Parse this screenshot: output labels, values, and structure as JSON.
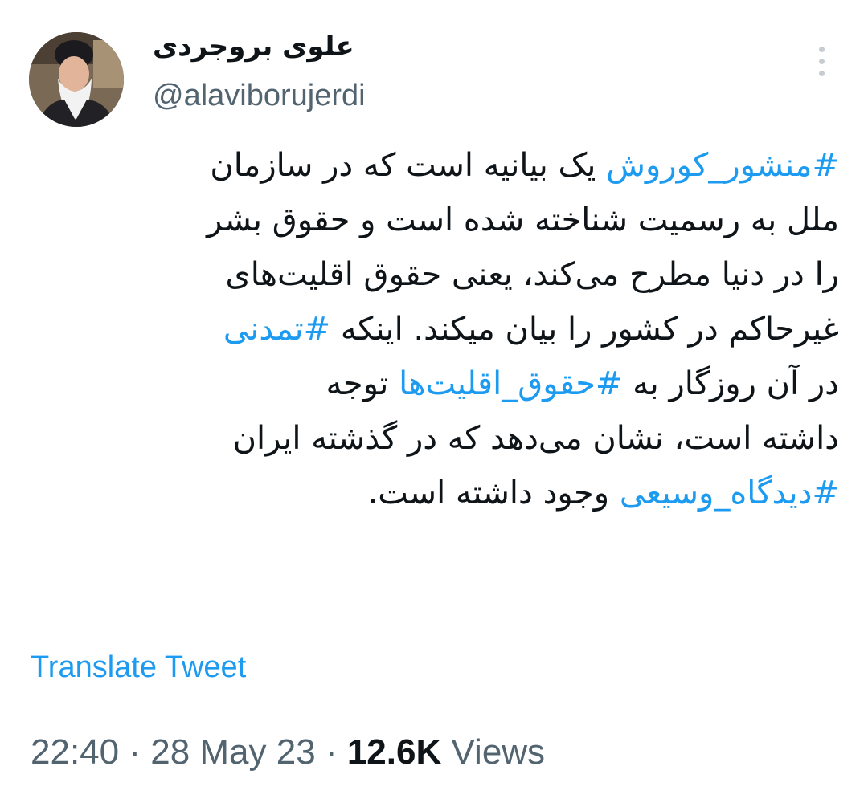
{
  "author": {
    "display_name": "علوی بروجردی",
    "handle": "@alaviborujerdi"
  },
  "tweet": {
    "lines": [
      [
        {
          "text": "#منشور_کوروش",
          "tag": true
        },
        {
          "text": " یک بیانیه است که در سازمان",
          "tag": false
        }
      ],
      [
        {
          "text": "ملل به رسمیت شناخته شده است و حقوق بشر",
          "tag": false
        }
      ],
      [
        {
          "text": "را در دنیا مطرح می‌کند، یعنی حقوق اقلیت‌های",
          "tag": false
        }
      ],
      [
        {
          "text": "غیرحاکم در کشور را بیان میکند. اینکه ",
          "tag": false
        },
        {
          "text": "#تمدنی",
          "tag": true
        }
      ],
      [
        {
          "text": "در آن روزگار به ",
          "tag": false
        },
        {
          "text": "#حقوق_اقلیت‌ها",
          "tag": true
        },
        {
          "text": " توجه",
          "tag": false
        }
      ],
      [
        {
          "text": "داشته است، نشان می‌دهد که در گذشته ایران",
          "tag": false
        }
      ],
      [
        {
          "text": "#دیدگاه_وسیعی",
          "tag": true
        },
        {
          "text": " وجود داشته است.",
          "tag": false
        }
      ]
    ]
  },
  "translate_label": "Translate Tweet",
  "meta": {
    "time": "22:40",
    "date": "28 May 23",
    "views_count": "12.6K",
    "views_label": "Views",
    "separator": "·"
  },
  "colors": {
    "link": "#1d9bf0",
    "secondary": "#536471",
    "text": "#0f1419"
  },
  "icons": {
    "more": "more-vertical-icon"
  }
}
